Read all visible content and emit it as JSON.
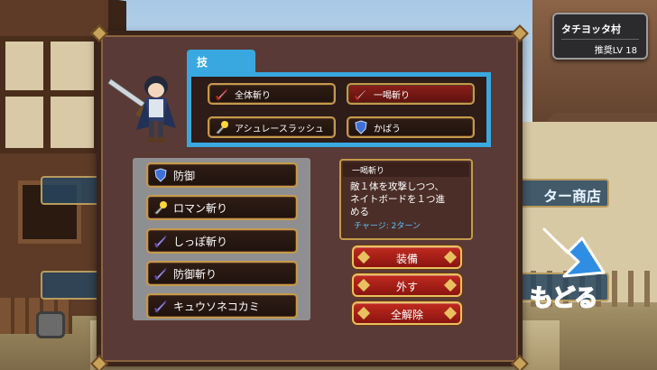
{
  "location": {
    "name": "タチヨッタ村",
    "level": "推奨LV 18"
  },
  "back_label": "もどる",
  "background_shop": "ター商店",
  "panel": {
    "tab_label": "技",
    "skills": [
      {
        "label": "全体斬り",
        "icon": "sword-icon",
        "selected": false
      },
      {
        "label": "一喝斬り",
        "icon": "sword-icon",
        "selected": true
      },
      {
        "label": "アシュレースラッシュ",
        "icon": "spark-sword-icon",
        "selected": false
      },
      {
        "label": "かばう",
        "icon": "shield-icon",
        "selected": false
      }
    ],
    "equipped": [
      {
        "label": "防御",
        "icon": "shield-icon"
      },
      {
        "label": "ロマン斬り",
        "icon": "spark-sword-icon"
      },
      {
        "label": "しっぽ斬り",
        "icon": "sword-icon"
      },
      {
        "label": "防御斬り",
        "icon": "sword-icon"
      },
      {
        "label": "キュウソネコカミ",
        "icon": "sword-icon"
      }
    ],
    "description": {
      "title": "一喝斬り",
      "line1": "敵１体を攻撃しつつ、",
      "line2": "ネイトボードを１つ進",
      "line3": "める",
      "charge": "チャージ: 2ターン"
    },
    "actions": {
      "equip": "装備",
      "remove": "外す",
      "remove_all": "全解除"
    }
  },
  "colors": {
    "accent": "#3aa8e0",
    "panel": "#5a3a36",
    "gold": "#c49a4c",
    "selected": "#8b1f1b"
  }
}
